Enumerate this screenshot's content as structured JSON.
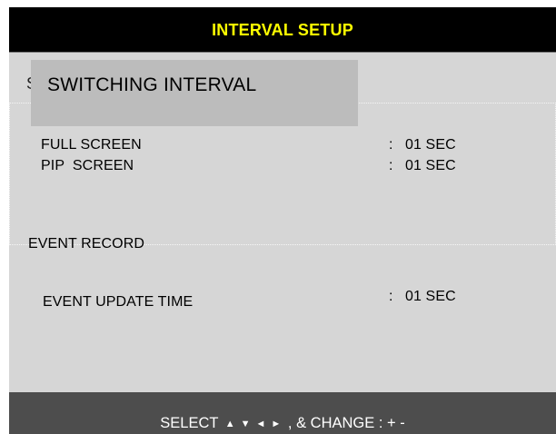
{
  "window": {
    "title": "INTERVAL SETUP"
  },
  "sections": {
    "switching": {
      "hidden_fragment": "S",
      "popup_label": "SWITCHING INTERVAL",
      "rows": [
        {
          "label": "FULL SCREEN",
          "separator": ":",
          "value": "01 SEC"
        },
        {
          "label": "PIP  SCREEN",
          "separator": ":",
          "value": "01 SEC"
        }
      ]
    },
    "event": {
      "heading": "EVENT RECORD",
      "rows": [
        {
          "label": "EVENT UPDATE TIME",
          "separator": ":",
          "value": "01 SEC"
        }
      ]
    }
  },
  "footer": {
    "select_label": "SELECT",
    "arrows": [
      "▲",
      "▼",
      "◄",
      "►"
    ],
    "change_label": ", & CHANGE : + -"
  },
  "colors": {
    "title_bg": "#000000",
    "title_text": "#ffff00",
    "panel_bg": "#d6d6d6",
    "popup_bg": "#bcbcbc",
    "footer_bg": "#4d4d4d"
  }
}
